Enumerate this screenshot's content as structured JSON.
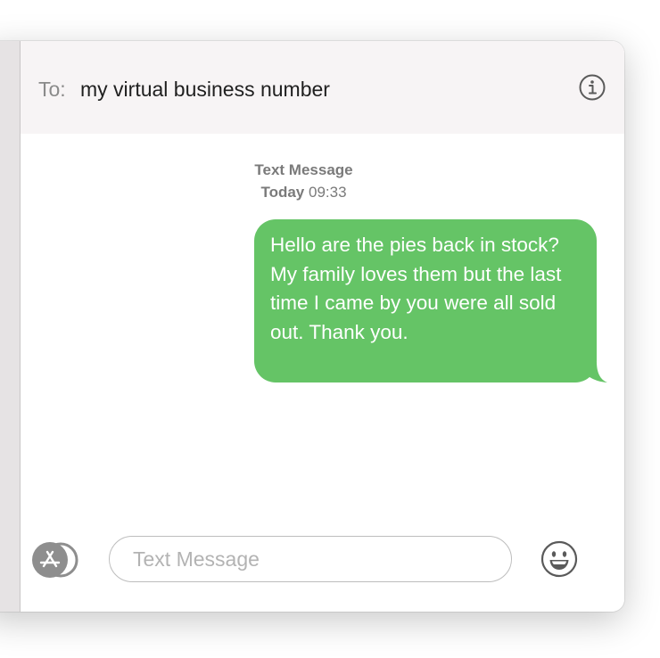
{
  "header": {
    "to_label": "To:",
    "recipient": "my virtual business number"
  },
  "icons": {
    "info": "info-icon",
    "app_store": "app-store-icon",
    "emoji": "smiley-face-icon"
  },
  "conversation": {
    "service_label": "Text Message",
    "timestamp_day": "Today",
    "timestamp_time": "09:33",
    "messages": [
      {
        "direction": "outgoing",
        "text": "Hello are the pies back in stock? My family loves them but the last time I came by you were all sold out. Thank you."
      }
    ]
  },
  "composer": {
    "placeholder": "Text Message",
    "value": ""
  },
  "colors": {
    "outgoing_bubble": "#65c466",
    "header_background": "#f7f4f5",
    "sidebar_background": "#e6e3e4",
    "icon_gray": "#5a5a5a"
  }
}
